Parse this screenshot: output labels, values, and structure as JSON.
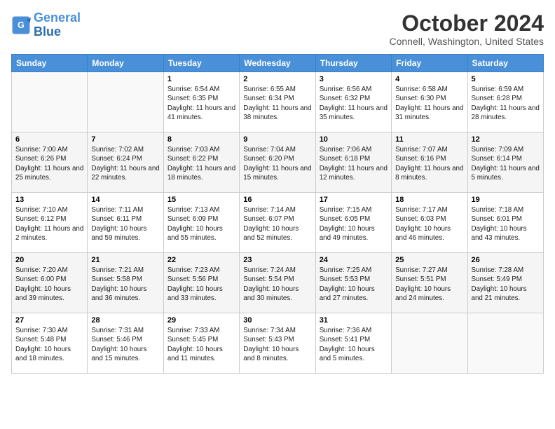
{
  "header": {
    "logo_line1": "General",
    "logo_line2": "Blue",
    "month": "October 2024",
    "location": "Connell, Washington, United States"
  },
  "weekdays": [
    "Sunday",
    "Monday",
    "Tuesday",
    "Wednesday",
    "Thursday",
    "Friday",
    "Saturday"
  ],
  "weeks": [
    [
      {
        "day": "",
        "content": ""
      },
      {
        "day": "",
        "content": ""
      },
      {
        "day": "1",
        "content": "Sunrise: 6:54 AM\nSunset: 6:35 PM\nDaylight: 11 hours and 41 minutes."
      },
      {
        "day": "2",
        "content": "Sunrise: 6:55 AM\nSunset: 6:34 PM\nDaylight: 11 hours and 38 minutes."
      },
      {
        "day": "3",
        "content": "Sunrise: 6:56 AM\nSunset: 6:32 PM\nDaylight: 11 hours and 35 minutes."
      },
      {
        "day": "4",
        "content": "Sunrise: 6:58 AM\nSunset: 6:30 PM\nDaylight: 11 hours and 31 minutes."
      },
      {
        "day": "5",
        "content": "Sunrise: 6:59 AM\nSunset: 6:28 PM\nDaylight: 11 hours and 28 minutes."
      }
    ],
    [
      {
        "day": "6",
        "content": "Sunrise: 7:00 AM\nSunset: 6:26 PM\nDaylight: 11 hours and 25 minutes."
      },
      {
        "day": "7",
        "content": "Sunrise: 7:02 AM\nSunset: 6:24 PM\nDaylight: 11 hours and 22 minutes."
      },
      {
        "day": "8",
        "content": "Sunrise: 7:03 AM\nSunset: 6:22 PM\nDaylight: 11 hours and 18 minutes."
      },
      {
        "day": "9",
        "content": "Sunrise: 7:04 AM\nSunset: 6:20 PM\nDaylight: 11 hours and 15 minutes."
      },
      {
        "day": "10",
        "content": "Sunrise: 7:06 AM\nSunset: 6:18 PM\nDaylight: 11 hours and 12 minutes."
      },
      {
        "day": "11",
        "content": "Sunrise: 7:07 AM\nSunset: 6:16 PM\nDaylight: 11 hours and 8 minutes."
      },
      {
        "day": "12",
        "content": "Sunrise: 7:09 AM\nSunset: 6:14 PM\nDaylight: 11 hours and 5 minutes."
      }
    ],
    [
      {
        "day": "13",
        "content": "Sunrise: 7:10 AM\nSunset: 6:12 PM\nDaylight: 11 hours and 2 minutes."
      },
      {
        "day": "14",
        "content": "Sunrise: 7:11 AM\nSunset: 6:11 PM\nDaylight: 10 hours and 59 minutes."
      },
      {
        "day": "15",
        "content": "Sunrise: 7:13 AM\nSunset: 6:09 PM\nDaylight: 10 hours and 55 minutes."
      },
      {
        "day": "16",
        "content": "Sunrise: 7:14 AM\nSunset: 6:07 PM\nDaylight: 10 hours and 52 minutes."
      },
      {
        "day": "17",
        "content": "Sunrise: 7:15 AM\nSunset: 6:05 PM\nDaylight: 10 hours and 49 minutes."
      },
      {
        "day": "18",
        "content": "Sunrise: 7:17 AM\nSunset: 6:03 PM\nDaylight: 10 hours and 46 minutes."
      },
      {
        "day": "19",
        "content": "Sunrise: 7:18 AM\nSunset: 6:01 PM\nDaylight: 10 hours and 43 minutes."
      }
    ],
    [
      {
        "day": "20",
        "content": "Sunrise: 7:20 AM\nSunset: 6:00 PM\nDaylight: 10 hours and 39 minutes."
      },
      {
        "day": "21",
        "content": "Sunrise: 7:21 AM\nSunset: 5:58 PM\nDaylight: 10 hours and 36 minutes."
      },
      {
        "day": "22",
        "content": "Sunrise: 7:23 AM\nSunset: 5:56 PM\nDaylight: 10 hours and 33 minutes."
      },
      {
        "day": "23",
        "content": "Sunrise: 7:24 AM\nSunset: 5:54 PM\nDaylight: 10 hours and 30 minutes."
      },
      {
        "day": "24",
        "content": "Sunrise: 7:25 AM\nSunset: 5:53 PM\nDaylight: 10 hours and 27 minutes."
      },
      {
        "day": "25",
        "content": "Sunrise: 7:27 AM\nSunset: 5:51 PM\nDaylight: 10 hours and 24 minutes."
      },
      {
        "day": "26",
        "content": "Sunrise: 7:28 AM\nSunset: 5:49 PM\nDaylight: 10 hours and 21 minutes."
      }
    ],
    [
      {
        "day": "27",
        "content": "Sunrise: 7:30 AM\nSunset: 5:48 PM\nDaylight: 10 hours and 18 minutes."
      },
      {
        "day": "28",
        "content": "Sunrise: 7:31 AM\nSunset: 5:46 PM\nDaylight: 10 hours and 15 minutes."
      },
      {
        "day": "29",
        "content": "Sunrise: 7:33 AM\nSunset: 5:45 PM\nDaylight: 10 hours and 11 minutes."
      },
      {
        "day": "30",
        "content": "Sunrise: 7:34 AM\nSunset: 5:43 PM\nDaylight: 10 hours and 8 minutes."
      },
      {
        "day": "31",
        "content": "Sunrise: 7:36 AM\nSunset: 5:41 PM\nDaylight: 10 hours and 5 minutes."
      },
      {
        "day": "",
        "content": ""
      },
      {
        "day": "",
        "content": ""
      }
    ]
  ]
}
